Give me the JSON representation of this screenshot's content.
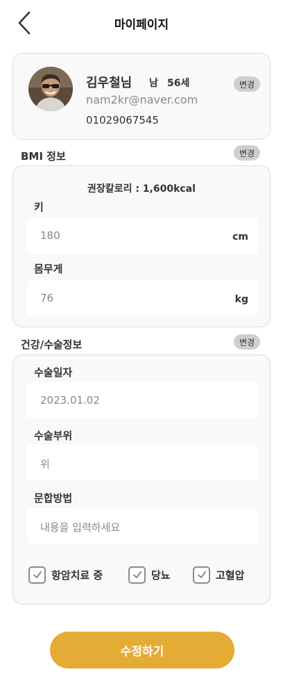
{
  "header": {
    "title": "마이페이지"
  },
  "profile": {
    "name": "김우철님",
    "gender": "남",
    "age": "56세",
    "email": "nam2kr@naver.com",
    "phone": "01029067545",
    "edit_label": "변경"
  },
  "bmi": {
    "title": "BMI 정보",
    "edit_label": "변경",
    "recommended": "권장칼로리 : 1,600kcal",
    "height_label": "키",
    "height_value": "180",
    "height_unit": "cm",
    "weight_label": "몸무게",
    "weight_value": "76",
    "weight_unit": "kg"
  },
  "health": {
    "title": "건강/수술정보",
    "edit_label": "변경",
    "surgery_date_label": "수술일자",
    "surgery_date_value": "2023.01.02",
    "surgery_site_label": "수술부위",
    "surgery_site_value": "위",
    "anastomosis_label": "문합방법",
    "anastomosis_placeholder": "내용을 입력하세요",
    "conditions": [
      {
        "label": "항암치료 중"
      },
      {
        "label": "당뇨"
      },
      {
        "label": "고혈압"
      }
    ]
  },
  "actions": {
    "submit_label": "수정하기"
  },
  "colors": {
    "accent": "#e4ab35",
    "card_bg": "#f9f9f9",
    "badge_bg": "#cfcfcf"
  },
  "icons": {
    "back": "chevron-left-icon",
    "check": "check-icon"
  }
}
